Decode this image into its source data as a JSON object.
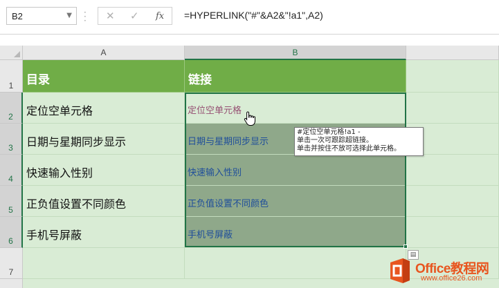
{
  "formula_bar": {
    "name_box": "B2",
    "cancel_symbol": "✕",
    "enter_symbol": "✓",
    "fx_label": "fx",
    "formula": "=HYPERLINK(\"#\"&A2&\"!a1\",A2)"
  },
  "columns": [
    "A",
    "B"
  ],
  "rows": [
    "1",
    "2",
    "3",
    "4",
    "5",
    "6",
    "7"
  ],
  "table": {
    "header_a": "目录",
    "header_b": "链接",
    "rows": [
      {
        "a": "定位空单元格",
        "b": "定位空单元格"
      },
      {
        "a": "日期与星期同步显示",
        "b": "日期与星期同步显示"
      },
      {
        "a": "快速输入性别",
        "b": "快速输入性别"
      },
      {
        "a": "正负值设置不同颜色",
        "b": "正负值设置不同颜色"
      },
      {
        "a": "手机号屏蔽",
        "b": "手机号屏蔽"
      }
    ]
  },
  "tooltip": {
    "line1": "#定位空单元格!a1 -",
    "line2": "单击一次可跟踪超链接。",
    "line3": "单击并按住不放可选择此单元格。"
  },
  "watermark": {
    "brand": "Office教程网",
    "url": "www.office26.com"
  },
  "colors": {
    "header_fill": "#70ad47",
    "sheet_fill": "#d9ecd5",
    "selection_fill": "#8fa88a",
    "link": "#1f4e9a",
    "visited_link": "#954f72",
    "accent": "#217346",
    "logo": "#e8551f"
  }
}
